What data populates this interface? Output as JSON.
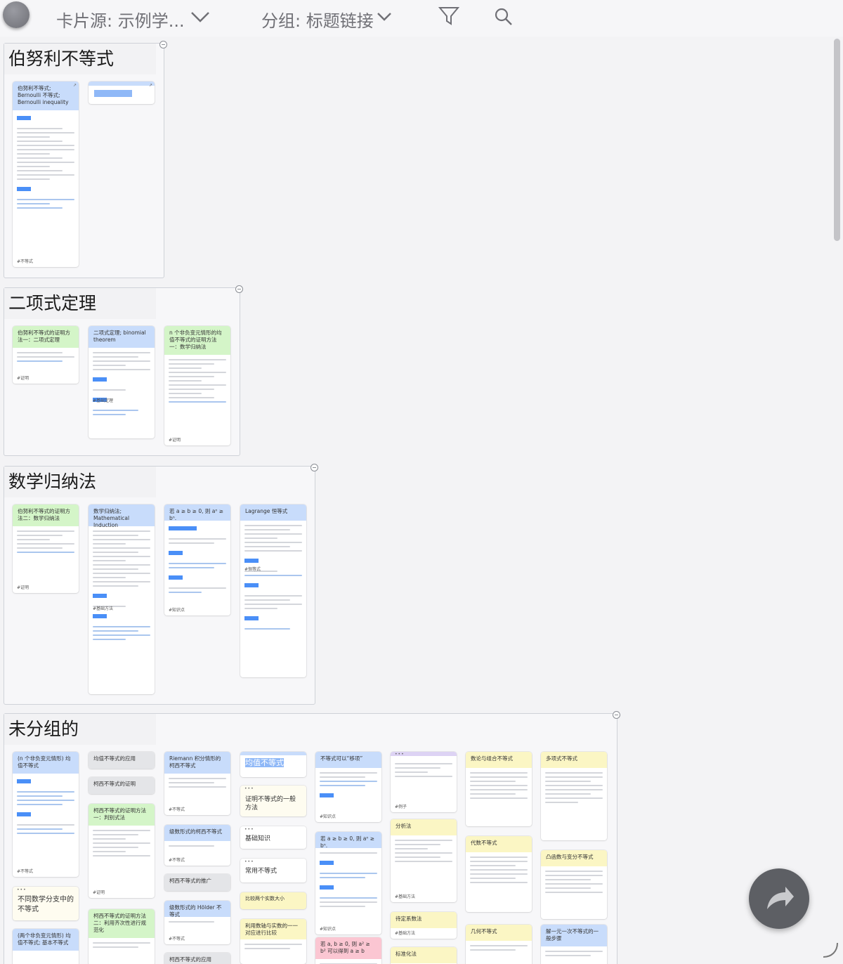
{
  "toolbar": {
    "card_source_label": "卡片源: 示例学...",
    "group_label": "分组: 标题链接"
  },
  "groups": {
    "bernoulli": {
      "title": "伯努利不等式",
      "cards": [
        {
          "title": "伯努利不等式; Bernoulli 不等式; Bernoulli inequality",
          "tag": "#不等式"
        }
      ]
    },
    "binomial": {
      "title": "二项式定理",
      "cards": [
        {
          "title": "伯努利不等式的证明方法一：二项式定理",
          "tag": "#证明"
        },
        {
          "title": "二项式定理; binomial theorem",
          "tag": "#基础定理"
        },
        {
          "title": "n 个非负变元情形的均值不等式的证明方法一：数学归纳法",
          "tag": "#证明"
        }
      ]
    },
    "induction": {
      "title": "数学归纳法",
      "cards": [
        {
          "title": "伯努利不等式的证明方法二：数学归纳法",
          "tag": "#证明"
        },
        {
          "title": "数学归纳法; Mathematical Induction",
          "tag": "#基础方法"
        },
        {
          "title": "若 a ≥ b ≥ 0, 则 aⁿ ≥ bⁿ.",
          "tag": "#知识点"
        },
        {
          "title": "Lagrange 恒等式",
          "tag": "#恒等式"
        }
      ]
    },
    "ungrouped": {
      "title": "未分组的",
      "cards": [
        {
          "title": "(n 个非负变元情形) 均值不等式",
          "tag": "#不等式"
        },
        {
          "title": "不同数学分支中的不等式"
        },
        {
          "title": "(两个非负变元情形) 均值不等式; 基本不等式"
        },
        {
          "title": "均值不等式的应用"
        },
        {
          "title": "柯西不等式的证明"
        },
        {
          "title": "柯西不等式的证明方法一：判别式法",
          "tag": "#证明"
        },
        {
          "title": "柯西不等式的证明方法二：利用齐次性进行规范化"
        },
        {
          "title": "Riemann 积分情形的柯西不等式",
          "tag": "#不等式"
        },
        {
          "title": "级数形式的柯西不等式",
          "tag": "#不等式"
        },
        {
          "title": "柯西不等式的推广"
        },
        {
          "title": "级数形式的 Hölder 不等式",
          "tag": "#不等式"
        },
        {
          "title": "柯西不等式的应用"
        },
        {
          "title": "均值不等式"
        },
        {
          "title": "证明不等式的一般方法"
        },
        {
          "title": "基础知识"
        },
        {
          "title": "常用不等式"
        },
        {
          "title": "比较两个实数大小"
        },
        {
          "title": "利用数轴与实数的一一对应进行比较"
        },
        {
          "title": "不等式可以“移项”",
          "tag": "#知识点"
        },
        {
          "title": "若 a ≥ b ≥ 0, 则 aⁿ ≥ bⁿ.",
          "tag": "#知识点"
        },
        {
          "title": "若 a, b ≥ 0, 则 a² ≥ b² 可以得到 a ≥ b"
        },
        {
          "title": "",
          "tag": "#例子"
        },
        {
          "title": "分析法",
          "tag": "#基础方法"
        },
        {
          "title": "待定系数法",
          "tag": "#基础方法"
        },
        {
          "title": "标准化法"
        },
        {
          "title": "数论与组合不等式"
        },
        {
          "title": "代数不等式"
        },
        {
          "title": "几何不等式"
        },
        {
          "title": "多项式不等式"
        },
        {
          "title": "凸函数与变分不等式"
        },
        {
          "title": "解一元一次不等式的一般步骤"
        }
      ]
    }
  },
  "colors": {
    "blue_head": "#c8dcfb",
    "green_head": "#d4f5c8",
    "gray_head": "#e4e5e8",
    "yellow_head": "#fbf6c4",
    "purple_head": "#ddd3f4",
    "pink_head": "#fbc6d2",
    "share_button": "#5d5f64"
  },
  "icons": [
    "avatar",
    "chevron-down-icon",
    "filter-icon",
    "search-icon",
    "share-icon",
    "collapse-icon"
  ]
}
